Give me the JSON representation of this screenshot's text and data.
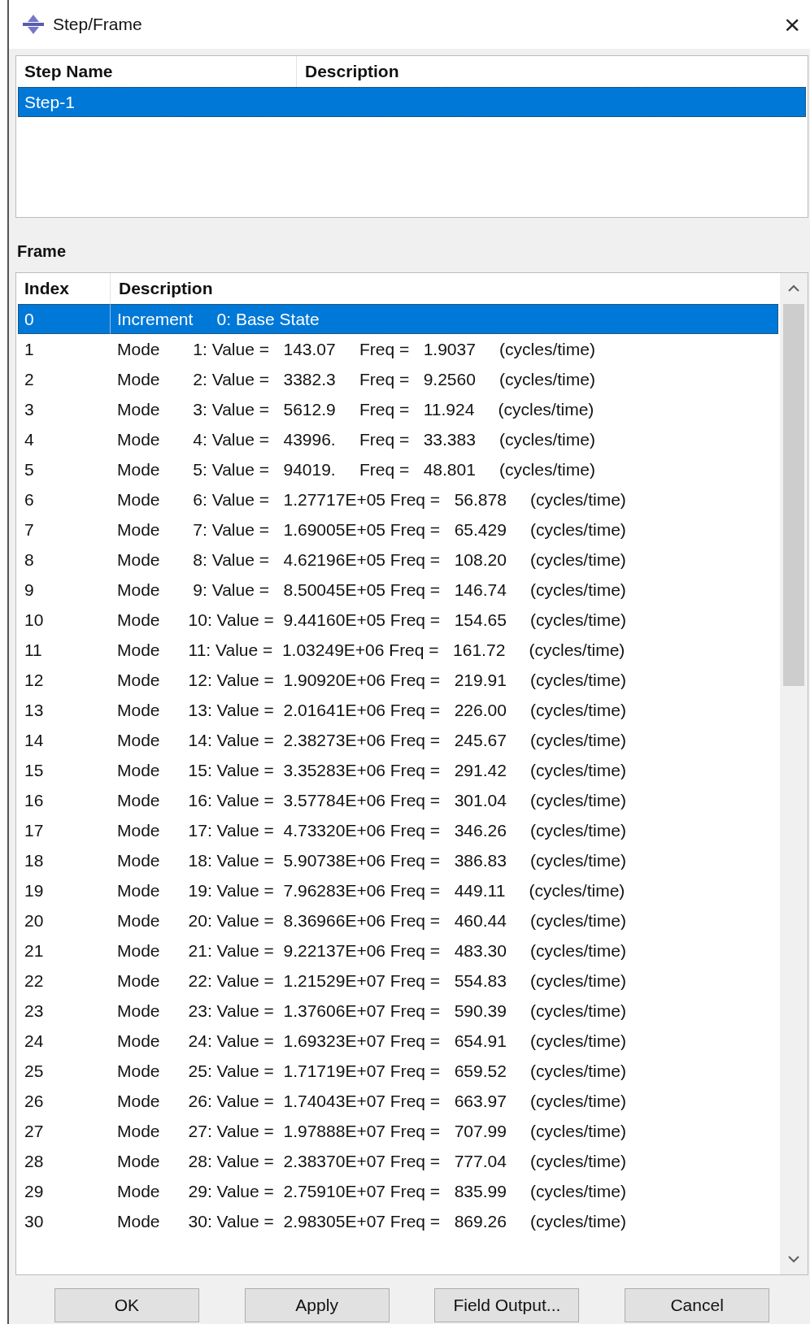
{
  "window": {
    "title": "Step/Frame",
    "close": "×"
  },
  "steps": {
    "columns": [
      "Step Name",
      "Description"
    ],
    "rows": [
      {
        "name": "Step-1",
        "description": "",
        "selected": true
      }
    ]
  },
  "frame": {
    "label": "Frame",
    "columns": [
      "Index",
      "Description"
    ],
    "rows": [
      {
        "index": "0",
        "description": "Increment     0: Base State",
        "selected": true
      },
      {
        "index": "1",
        "description": "Mode       1: Value =   143.07     Freq =   1.9037     (cycles/time)",
        "selected": false
      },
      {
        "index": "2",
        "description": "Mode       2: Value =   3382.3     Freq =   9.2560     (cycles/time)",
        "selected": false
      },
      {
        "index": "3",
        "description": "Mode       3: Value =   5612.9     Freq =   11.924     (cycles/time)",
        "selected": false
      },
      {
        "index": "4",
        "description": "Mode       4: Value =   43996.     Freq =   33.383     (cycles/time)",
        "selected": false
      },
      {
        "index": "5",
        "description": "Mode       5: Value =   94019.     Freq =   48.801     (cycles/time)",
        "selected": false
      },
      {
        "index": "6",
        "description": "Mode       6: Value =   1.27717E+05 Freq =   56.878     (cycles/time)",
        "selected": false
      },
      {
        "index": "7",
        "description": "Mode       7: Value =   1.69005E+05 Freq =   65.429     (cycles/time)",
        "selected": false
      },
      {
        "index": "8",
        "description": "Mode       8: Value =   4.62196E+05 Freq =   108.20     (cycles/time)",
        "selected": false
      },
      {
        "index": "9",
        "description": "Mode       9: Value =   8.50045E+05 Freq =   146.74     (cycles/time)",
        "selected": false
      },
      {
        "index": "10",
        "description": "Mode      10: Value =  9.44160E+05 Freq =   154.65     (cycles/time)",
        "selected": false
      },
      {
        "index": "11",
        "description": "Mode      11: Value =  1.03249E+06 Freq =   161.72     (cycles/time)",
        "selected": false
      },
      {
        "index": "12",
        "description": "Mode      12: Value =  1.90920E+06 Freq =   219.91     (cycles/time)",
        "selected": false
      },
      {
        "index": "13",
        "description": "Mode      13: Value =  2.01641E+06 Freq =   226.00     (cycles/time)",
        "selected": false
      },
      {
        "index": "14",
        "description": "Mode      14: Value =  2.38273E+06 Freq =   245.67     (cycles/time)",
        "selected": false
      },
      {
        "index": "15",
        "description": "Mode      15: Value =  3.35283E+06 Freq =   291.42     (cycles/time)",
        "selected": false
      },
      {
        "index": "16",
        "description": "Mode      16: Value =  3.57784E+06 Freq =   301.04     (cycles/time)",
        "selected": false
      },
      {
        "index": "17",
        "description": "Mode      17: Value =  4.73320E+06 Freq =   346.26     (cycles/time)",
        "selected": false
      },
      {
        "index": "18",
        "description": "Mode      18: Value =  5.90738E+06 Freq =   386.83     (cycles/time)",
        "selected": false
      },
      {
        "index": "19",
        "description": "Mode      19: Value =  7.96283E+06 Freq =   449.11     (cycles/time)",
        "selected": false
      },
      {
        "index": "20",
        "description": "Mode      20: Value =  8.36966E+06 Freq =   460.44     (cycles/time)",
        "selected": false
      },
      {
        "index": "21",
        "description": "Mode      21: Value =  9.22137E+06 Freq =   483.30     (cycles/time)",
        "selected": false
      },
      {
        "index": "22",
        "description": "Mode      22: Value =  1.21529E+07 Freq =   554.83     (cycles/time)",
        "selected": false
      },
      {
        "index": "23",
        "description": "Mode      23: Value =  1.37606E+07 Freq =   590.39     (cycles/time)",
        "selected": false
      },
      {
        "index": "24",
        "description": "Mode      24: Value =  1.69323E+07 Freq =   654.91     (cycles/time)",
        "selected": false
      },
      {
        "index": "25",
        "description": "Mode      25: Value =  1.71719E+07 Freq =   659.52     (cycles/time)",
        "selected": false
      },
      {
        "index": "26",
        "description": "Mode      26: Value =  1.74043E+07 Freq =   663.97     (cycles/time)",
        "selected": false
      },
      {
        "index": "27",
        "description": "Mode      27: Value =  1.97888E+07 Freq =   707.99     (cycles/time)",
        "selected": false
      },
      {
        "index": "28",
        "description": "Mode      28: Value =  2.38370E+07 Freq =   777.04     (cycles/time)",
        "selected": false
      },
      {
        "index": "29",
        "description": "Mode      29: Value =  2.75910E+07 Freq =   835.99     (cycles/time)",
        "selected": false
      },
      {
        "index": "30",
        "description": "Mode      30: Value =  2.98305E+07 Freq =   869.26     (cycles/time)",
        "selected": false
      }
    ]
  },
  "buttons": [
    "OK",
    "Apply",
    "Field Output...",
    "Cancel"
  ]
}
